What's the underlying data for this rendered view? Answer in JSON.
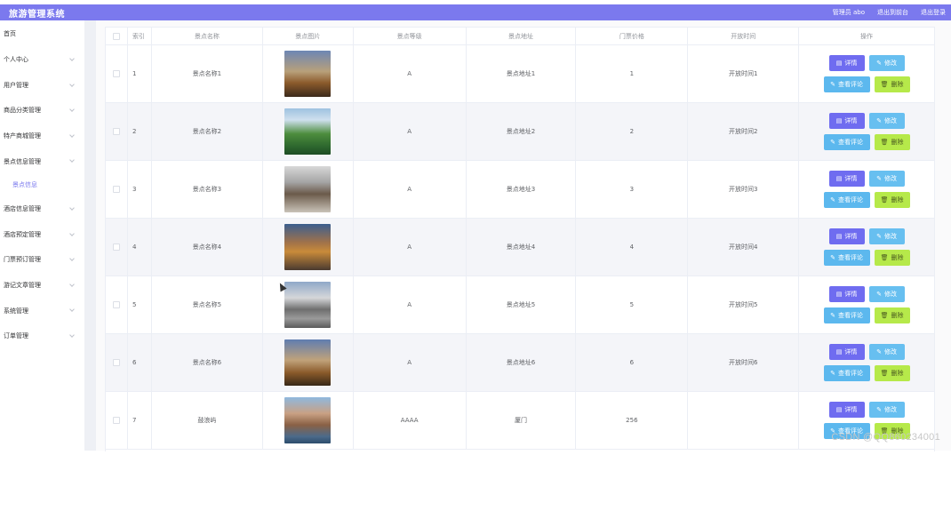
{
  "app": {
    "title": "旅游管理系统",
    "user_label": "管理员 abo",
    "back_to_front": "退出到前台",
    "logout": "退出登录"
  },
  "sidebar": {
    "items": [
      {
        "label": "首页",
        "has_arrow": false
      },
      {
        "label": "个人中心",
        "has_arrow": true
      },
      {
        "label": "用户管理",
        "has_arrow": true
      },
      {
        "label": "商品分类管理",
        "has_arrow": true
      },
      {
        "label": "特产商城管理",
        "has_arrow": true
      },
      {
        "label": "景点信息管理",
        "has_arrow": true
      },
      {
        "label": "景点信息",
        "has_arrow": false,
        "active": true
      },
      {
        "label": "酒店信息管理",
        "has_arrow": true
      },
      {
        "label": "酒店预定管理",
        "has_arrow": true
      },
      {
        "label": "门票预订管理",
        "has_arrow": true
      },
      {
        "label": "游记文章管理",
        "has_arrow": true
      },
      {
        "label": "系统管理",
        "has_arrow": true
      },
      {
        "label": "订单管理",
        "has_arrow": true
      }
    ]
  },
  "table": {
    "headers": [
      "索引",
      "景点名称",
      "景点图片",
      "景点等级",
      "景点地址",
      "门票价格",
      "开放时间",
      "操作"
    ],
    "rows": [
      {
        "index": "1",
        "name": "景点名称1",
        "level": "A",
        "address": "景点地址1",
        "price": "1",
        "open_time": "开放时间1"
      },
      {
        "index": "2",
        "name": "景点名称2",
        "level": "A",
        "address": "景点地址2",
        "price": "2",
        "open_time": "开放时间2"
      },
      {
        "index": "3",
        "name": "景点名称3",
        "level": "A",
        "address": "景点地址3",
        "price": "3",
        "open_time": "开放时间3"
      },
      {
        "index": "4",
        "name": "景点名称4",
        "level": "A",
        "address": "景点地址4",
        "price": "4",
        "open_time": "开放时间4"
      },
      {
        "index": "5",
        "name": "景点名称5",
        "level": "A",
        "address": "景点地址5",
        "price": "5",
        "open_time": "开放时间5"
      },
      {
        "index": "6",
        "name": "景点名称6",
        "level": "A",
        "address": "景点地址6",
        "price": "6",
        "open_time": "开放时间6"
      },
      {
        "index": "7",
        "name": "鼓浪屿",
        "level": "AAAA",
        "address": "厦门",
        "price": "256",
        "open_time": ""
      }
    ],
    "actions": {
      "detail": "详情",
      "edit": "修改",
      "review": "查看评论",
      "delete": "删除"
    }
  },
  "icons": {
    "detail": "document-icon",
    "edit": "pencil-icon",
    "review": "pencil-icon",
    "delete": "trash-icon",
    "menu_arrow": "chevron-down-icon"
  },
  "colors": {
    "topbar": "#7b79ee",
    "detail_button": "#6f6cf0",
    "edit_button": "#67bff0",
    "review_button": "#5cb8ee",
    "delete_button": "#b6e94a",
    "active_menu": "#7b79ee"
  },
  "watermark": "CSDN @QQ860234001"
}
